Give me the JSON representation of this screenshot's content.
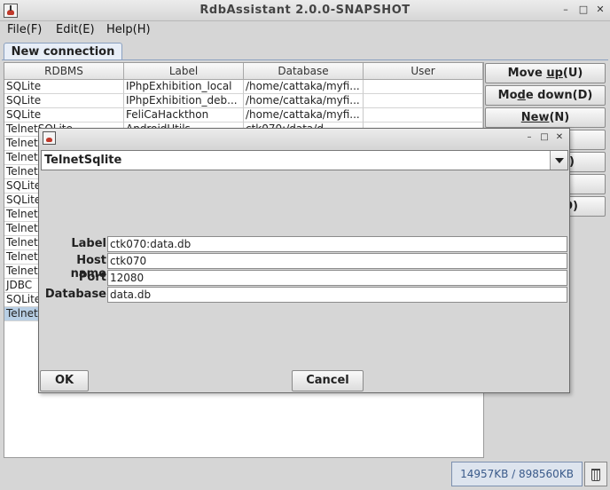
{
  "window": {
    "title": "RdbAssistant 2.0.0-SNAPSHOT"
  },
  "menu": {
    "file": "File(F)",
    "edit": "Edit(E)",
    "help": "Help(H)"
  },
  "tab": {
    "label": "New connection"
  },
  "table": {
    "columns": [
      "RDBMS",
      "Label",
      "Database",
      "User"
    ],
    "rows": [
      [
        "SQLite",
        "IPhpExhibition_local",
        "/home/cattaka/myfi...",
        ""
      ],
      [
        "SQLite",
        "IPhpExhibition_deb...",
        "/home/cattaka/myfi...",
        ""
      ],
      [
        "SQLite",
        "FeliCaHackthon",
        "/home/cattaka/myfi...",
        ""
      ],
      [
        "TelnetSQLite",
        "AndroidUtils",
        "ctk070:/data/d...",
        ""
      ],
      [
        "Telnet",
        "",
        "",
        ""
      ],
      [
        "Telnet",
        "",
        "",
        ""
      ],
      [
        "Telnet",
        "",
        "",
        ""
      ],
      [
        "SQLite",
        "",
        "",
        ""
      ],
      [
        "SQLite",
        "",
        "",
        ""
      ],
      [
        "Telnet",
        "",
        "",
        ""
      ],
      [
        "Telnet",
        "",
        "",
        ""
      ],
      [
        "Telnet",
        "",
        "",
        ""
      ],
      [
        "Telnet",
        "",
        "",
        ""
      ],
      [
        "Telnet",
        "",
        "",
        ""
      ],
      [
        "JDBC",
        "",
        "",
        ""
      ],
      [
        "SQLite",
        "",
        "",
        ""
      ],
      [
        "Telnet",
        "",
        "",
        ""
      ]
    ]
  },
  "buttons": {
    "move_up": {
      "pre": "Move ",
      "key": "up",
      "post": "(U)"
    },
    "move_down": {
      "pre": "Mo",
      "key": "d",
      "post": "e down(D)"
    },
    "new": {
      "pre": "",
      "key": "New",
      "post": "(N)"
    },
    "b4": "",
    "b5": "(I)",
    "b6": "",
    "b7": "(D)"
  },
  "status": {
    "memory": "14957KB / 898560KB"
  },
  "dialog": {
    "rdbms": "TelnetSqlite",
    "label_caption": "Label",
    "label_value": "ctk070:data.db",
    "host_caption": "Host name",
    "host_value": "ctk070",
    "port_caption": "Port",
    "port_value": "12080",
    "db_caption": "Database",
    "db_value": "data.db",
    "ok": "OK",
    "cancel": "Cancel"
  },
  "icons": {
    "app": "duke-java-icon",
    "trash": "trash-icon",
    "minimize": "minimize-icon",
    "maximize": "maximize-icon",
    "close": "close-icon",
    "combo": "chevron-down-icon"
  }
}
